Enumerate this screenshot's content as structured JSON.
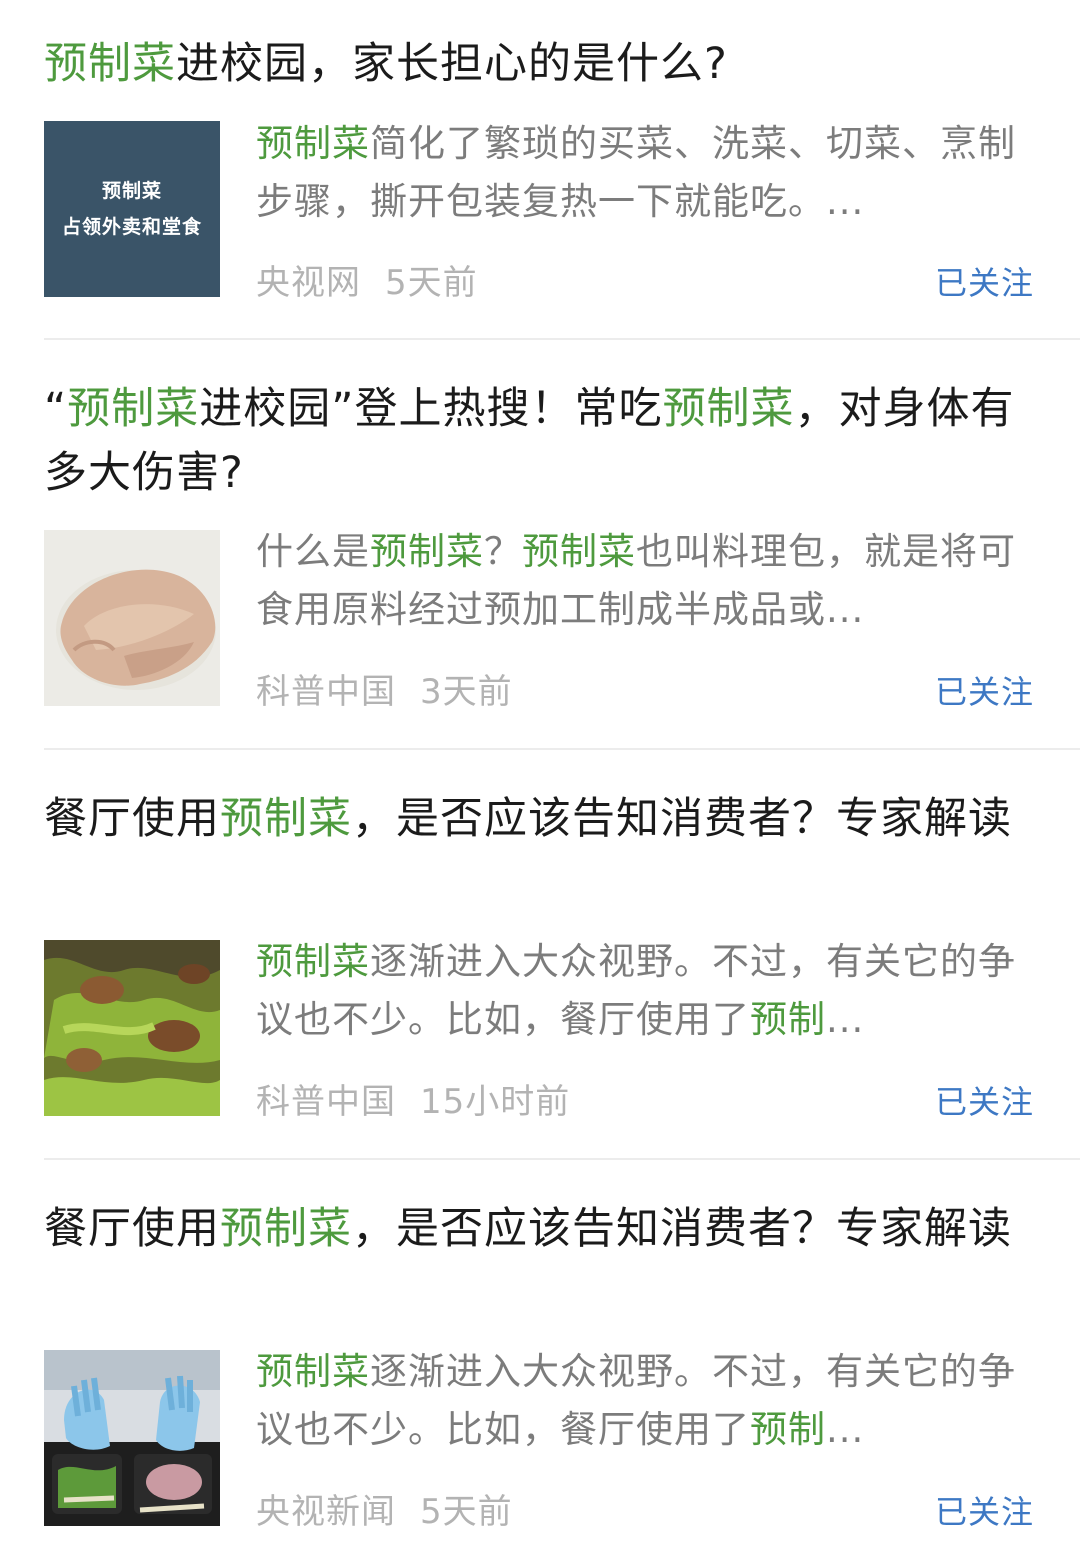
{
  "highlight_term": "预制菜",
  "colors": {
    "highlight": "#4e9a3e",
    "follow": "#3d78c4",
    "meta": "#b3b3b3",
    "snippet": "#7c7c7c"
  },
  "articles": [
    {
      "title": [
        {
          "t": "预制菜",
          "hl": true
        },
        {
          "t": "进校园，家长担心的是什么?",
          "hl": false
        }
      ],
      "thumbnail": {
        "kind": "text-card",
        "lines": [
          "预制菜",
          "占领外卖和堂食"
        ]
      },
      "snippet": [
        {
          "t": "预制菜",
          "hl": true
        },
        {
          "t": "简化了繁琐的买菜、洗菜、切菜、烹制步骤，撕开包装复热一下就能吃。...",
          "hl": false
        }
      ],
      "source": "央视网",
      "time": "5天前",
      "follow_label": "已关注"
    },
    {
      "title": [
        {
          "t": "“",
          "hl": false
        },
        {
          "t": "预制菜",
          "hl": true
        },
        {
          "t": "进校园”登上热搜！常吃",
          "hl": false
        },
        {
          "t": "预制菜",
          "hl": true
        },
        {
          "t": "，对身体有多大伤害?",
          "hl": false
        }
      ],
      "thumbnail": {
        "kind": "photo-chicken"
      },
      "snippet": [
        {
          "t": "什么是",
          "hl": false
        },
        {
          "t": "预制菜",
          "hl": true
        },
        {
          "t": "？",
          "hl": false
        },
        {
          "t": "预制菜",
          "hl": true
        },
        {
          "t": "也叫料理包，就是将可食用原料经过预加工制成半成品或...",
          "hl": false
        }
      ],
      "source": "科普中国",
      "time": "3天前",
      "follow_label": "已关注"
    },
    {
      "title": [
        {
          "t": "餐厅使用",
          "hl": false
        },
        {
          "t": "预制菜",
          "hl": true
        },
        {
          "t": "，是否应该告知消费者？专家解读",
          "hl": false
        }
      ],
      "thumbnail": {
        "kind": "photo-stirfry"
      },
      "snippet": [
        {
          "t": "预制菜",
          "hl": true
        },
        {
          "t": "逐渐进入大众视野。不过，有关它的争议也不少。比如，餐厅使用了",
          "hl": false
        },
        {
          "t": "预制",
          "hl": true
        },
        {
          "t": "...",
          "hl": false
        }
      ],
      "source": "科普中国",
      "time": "15小时前",
      "follow_label": "已关注"
    },
    {
      "title": [
        {
          "t": "餐厅使用",
          "hl": false
        },
        {
          "t": "预制菜",
          "hl": true
        },
        {
          "t": "，是否应该告知消费者？专家解读",
          "hl": false
        }
      ],
      "thumbnail": {
        "kind": "photo-gloves"
      },
      "snippet": [
        {
          "t": "预制菜",
          "hl": true
        },
        {
          "t": "逐渐进入大众视野。不过，有关它的争议也不少。比如，餐厅使用了",
          "hl": false
        },
        {
          "t": "预制",
          "hl": true
        },
        {
          "t": "...",
          "hl": false
        }
      ],
      "source": "央视新闻",
      "time": "5天前",
      "follow_label": "已关注"
    }
  ]
}
